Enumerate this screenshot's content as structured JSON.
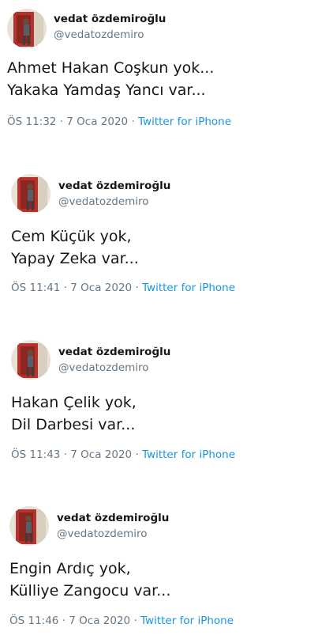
{
  "tweets": [
    {
      "author_name": "vedat özdemiroğlu",
      "author_handle": "@vedatozdemiro",
      "lines": [
        "Ahmet Hakan Coşkun yok...",
        "Yakaka Yamdaş Yancı var..."
      ],
      "time": "ÖS 11:32",
      "sep1": "·",
      "date": "7 Oca 2020",
      "sep2": "·",
      "source": "Twitter for iPhone"
    },
    {
      "author_name": "vedat özdemiroğlu",
      "author_handle": "@vedatozdemiro",
      "lines": [
        "Cem Küçük yok,",
        "Yapay Zeka var..."
      ],
      "time": "ÖS 11:41",
      "sep1": "·",
      "date": "7 Oca 2020",
      "sep2": "·",
      "source": "Twitter for iPhone"
    },
    {
      "author_name": "vedat özdemiroğlu",
      "author_handle": "@vedatozdemiro",
      "lines": [
        "Hakan Çelik yok,",
        "Dil Darbesi var..."
      ],
      "time": "ÖS 11:43",
      "sep1": "·",
      "date": "7 Oca 2020",
      "sep2": "·",
      "source": "Twitter for iPhone"
    },
    {
      "author_name": "vedat özdemiroğlu",
      "author_handle": "@vedatozdemiro",
      "lines": [
        "Engin Ardıç yok,",
        "Külliye Zangocu var..."
      ],
      "time": "ÖS 11:46",
      "sep1": "·",
      "date": "7 Oca 2020",
      "sep2": "·",
      "source": "Twitter for iPhone"
    }
  ],
  "colors": {
    "name": "#14171a",
    "secondary": "#657786",
    "link": "#1b95e0"
  }
}
